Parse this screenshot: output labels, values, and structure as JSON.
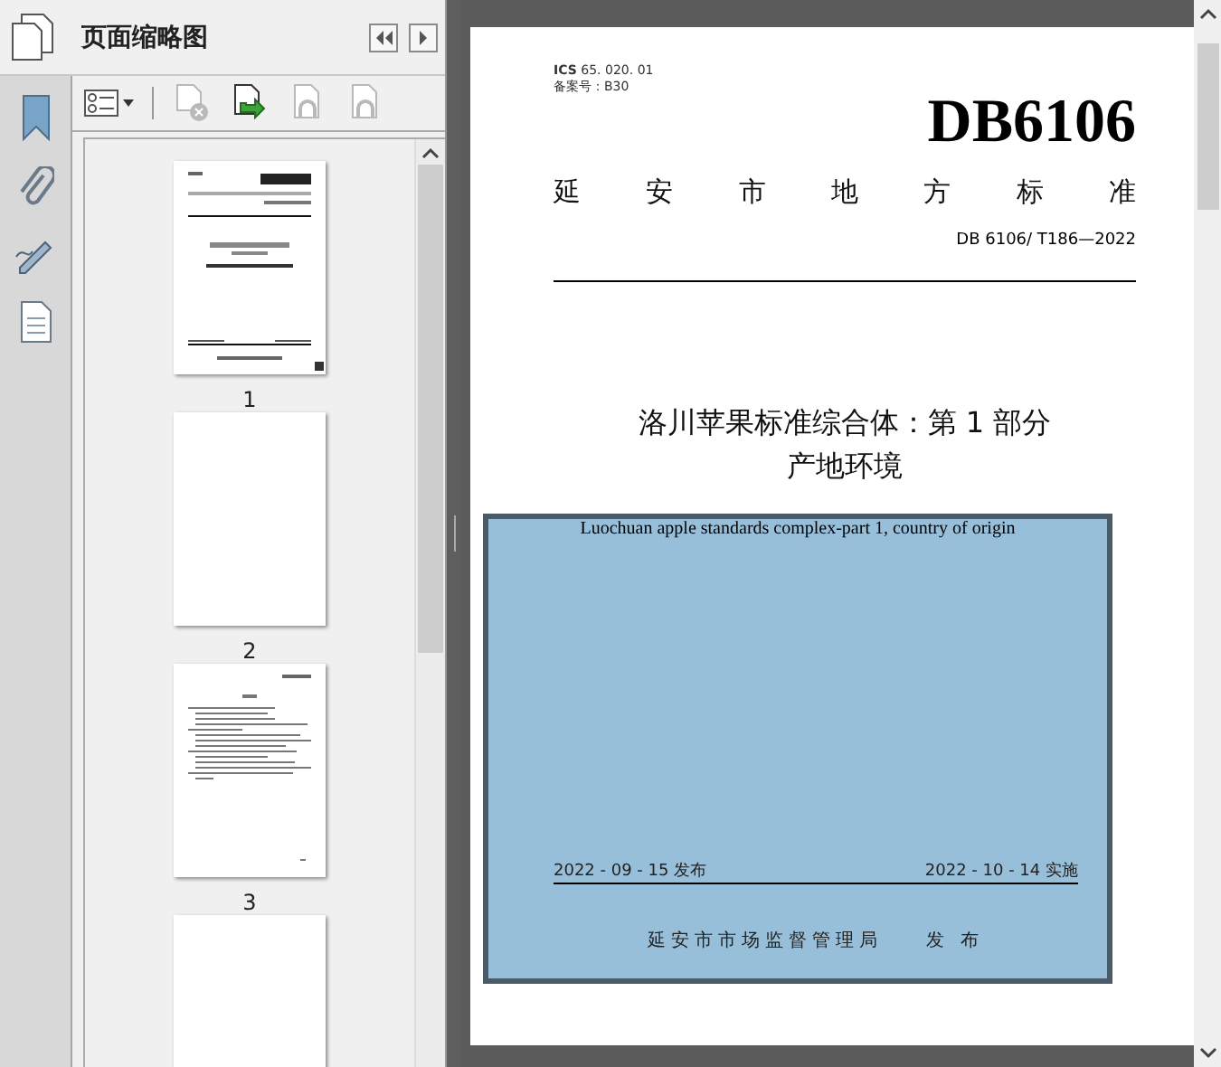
{
  "panel": {
    "title": "页面缩略图"
  },
  "nav_rail": [
    {
      "kind": "bookmark"
    },
    {
      "kind": "paperclip"
    },
    {
      "kind": "pen"
    },
    {
      "kind": "document"
    }
  ],
  "toolbar": [
    {
      "kind": "delete",
      "disabled": true
    },
    {
      "kind": "insert",
      "disabled": false
    },
    {
      "kind": "undo",
      "disabled": true
    },
    {
      "kind": "redo",
      "disabled": true
    }
  ],
  "thumbnails": [
    {
      "label": "1",
      "kind": "cover"
    },
    {
      "label": "2",
      "kind": "blank"
    },
    {
      "label": "3",
      "kind": "text"
    },
    {
      "kind": "blank"
    }
  ],
  "document": {
    "ics_label": "ICS",
    "ics_code": "65. 020. 01",
    "record_no": "备案号：B30",
    "code": "DB6106",
    "category": "延安市地方标准",
    "standard_no": "DB 6106/ T186—2022",
    "title_lines": [
      "洛川苹果标准综合体：第 1 部分",
      "产地环境"
    ],
    "english_title": "Luochuan apple standards complex-part 1, country of origin",
    "issue_date": "2022 - 09 - 15 发布",
    "effective_date": "2022 - 10 - 14 实施",
    "issuer": "延安市市场监督管理局",
    "issue_word": "发 布"
  }
}
